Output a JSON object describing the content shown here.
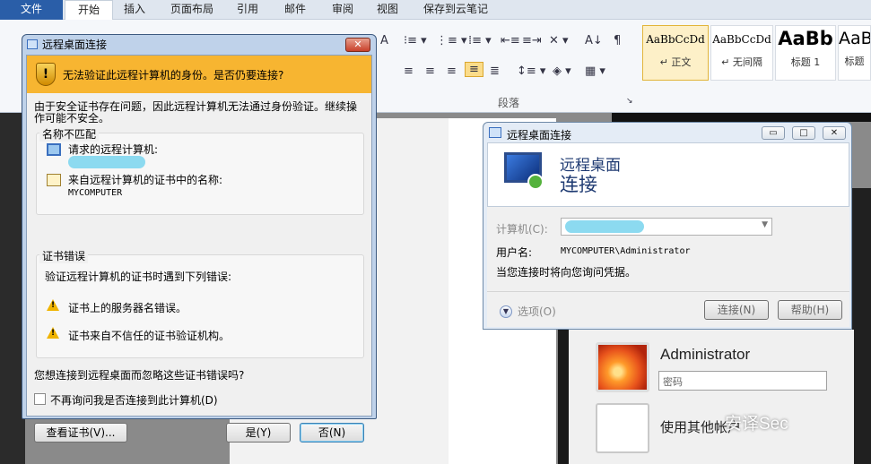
{
  "ribbon": {
    "tabs": [
      "文件",
      "开始",
      "插入",
      "页面布局",
      "引用",
      "邮件",
      "审阅",
      "视图",
      "保存到云笔记"
    ],
    "group_paragraph": "段落",
    "styles": [
      {
        "sample": "AaBbCcDd",
        "name": "↵ 正文"
      },
      {
        "sample": "AaBbCcDd",
        "name": "↵ 无间隔"
      },
      {
        "sample": "AaBb",
        "name": "标题 1"
      },
      {
        "sample": "AaB",
        "name": "标题"
      }
    ]
  },
  "dialog1": {
    "title": "远程桌面连接",
    "close": "✕",
    "warning": "无法验证此远程计算机的身份。是否仍要连接?",
    "intro1": "由于安全证书存在问题，因此远程计算机无法通过身份验证。继续操",
    "intro2": "作可能不安全。",
    "mismatch_label": "名称不匹配",
    "requested_label": "请求的远程计算机:",
    "cert_name_label": "来自远程计算机的证书中的名称:",
    "cert_name_value": "MYCOMPUTER",
    "cert_error_label": "证书错误",
    "cert_error_desc": "验证远程计算机的证书时遇到下列错误:",
    "error1": "证书上的服务器名错误。",
    "error2": "证书来自不信任的证书验证机构。",
    "question": "您想连接到远程桌面而忽略这些证书错误吗?",
    "dont_ask": "不再询问我是否连接到此计算机(D)",
    "view_cert": "查看证书(V)...",
    "yes": "是(Y)",
    "no": "否(N)"
  },
  "dialog2": {
    "title": "远程桌面连接",
    "heading1": "远程桌面",
    "heading2": "连接",
    "computer_label": "计算机(C):",
    "username_label": "用户名:",
    "username_value": "MYCOMPUTER\\Administrator",
    "credential_note": "当您连接时将向您询问凭据。",
    "options": "选项(O)",
    "connect": "连接(N)",
    "help": "帮助(H)",
    "min": "▭",
    "max": "□",
    "close": "✕"
  },
  "login": {
    "user": "Administrator",
    "password_placeholder": "密码",
    "other_user": "使用其他帐户"
  },
  "watermark": "安译Sec"
}
